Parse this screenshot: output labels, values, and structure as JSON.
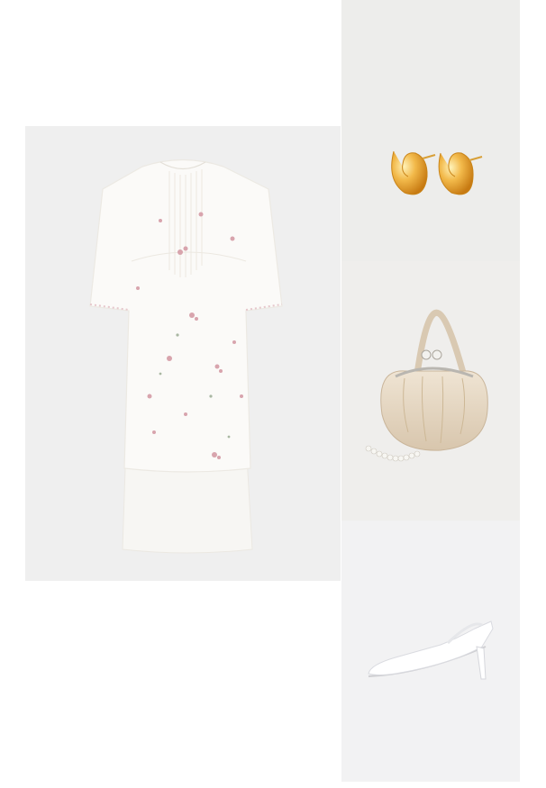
{
  "outfit": {
    "items": [
      {
        "name": "dress",
        "icon": "white-embroidered-dress"
      },
      {
        "name": "earrings",
        "icon": "gold-drop-earrings"
      },
      {
        "name": "bag",
        "icon": "beige-frame-clutch-bag"
      },
      {
        "name": "shoe",
        "icon": "white-slingback-pump"
      }
    ]
  },
  "colors": {
    "page_background": "#ffffff",
    "tile_background": "#efefef",
    "dress": "#fbfaf8",
    "embroidery": "#d8a4ad",
    "gold": "#e8a530",
    "bag": "#e7d9c4",
    "shoe": "#ffffff"
  }
}
